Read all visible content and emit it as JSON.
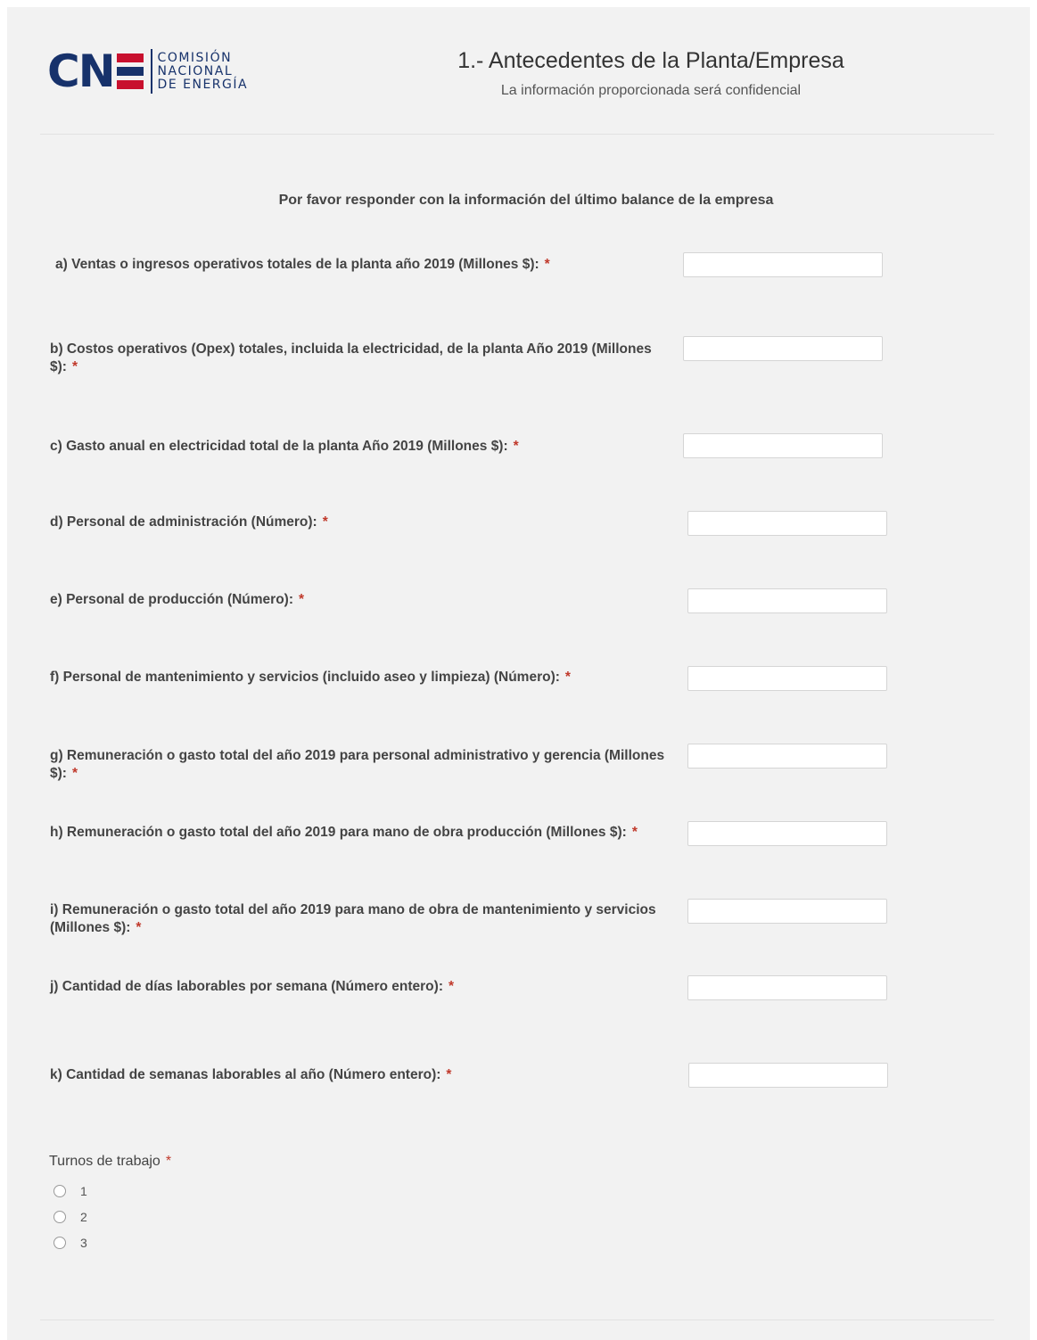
{
  "header": {
    "logo_text_cne": "CN",
    "logo_lines": [
      "COMISIÓN",
      "NACIONAL",
      "DE ENERGÍA"
    ],
    "title": "1.- Antecedentes de la Planta/Empresa",
    "subtitle": "La información proporcionada será confidencial"
  },
  "intro": "Por favor responder con la información del último balance de la empresa",
  "required_marker": "*",
  "questions": [
    {
      "label": "a) Ventas o ingresos operativos totales de la planta año 2019 (Millones $):",
      "value": ""
    },
    {
      "label": "b) Costos operativos (Opex) totales, incluida la electricidad, de la planta Año 2019 (Millones $):",
      "value": ""
    },
    {
      "label": "c) Gasto anual en electricidad total de la planta Año 2019 (Millones $):",
      "value": ""
    },
    {
      "label": "d) Personal de administración (Número):",
      "value": ""
    },
    {
      "label": "e) Personal de producción (Número):",
      "value": ""
    },
    {
      "label": "f) Personal de mantenimiento y servicios (incluido aseo y limpieza) (Número):",
      "value": ""
    },
    {
      "label": "g) Remuneración o gasto total del año 2019 para personal administrativo y gerencia (Millones $):",
      "value": ""
    },
    {
      "label": "h) Remuneración o gasto total del año 2019 para mano de obra producción (Millones $):",
      "value": ""
    },
    {
      "label": "i) Remuneración o gasto total del año 2019 para mano de obra de mantenimiento y servicios (Millones $):",
      "value": ""
    },
    {
      "label": "j) Cantidad de días laborables por semana (Número entero):",
      "value": ""
    },
    {
      "label": "k) Cantidad de semanas laborables al año (Número entero):",
      "value": ""
    }
  ],
  "turnos": {
    "label": "Turnos de trabajo",
    "options": [
      "1",
      "2",
      "3"
    ]
  },
  "colors": {
    "brand_blue": "#17326b",
    "brand_red": "#c8102e",
    "required": "#c0392b"
  }
}
